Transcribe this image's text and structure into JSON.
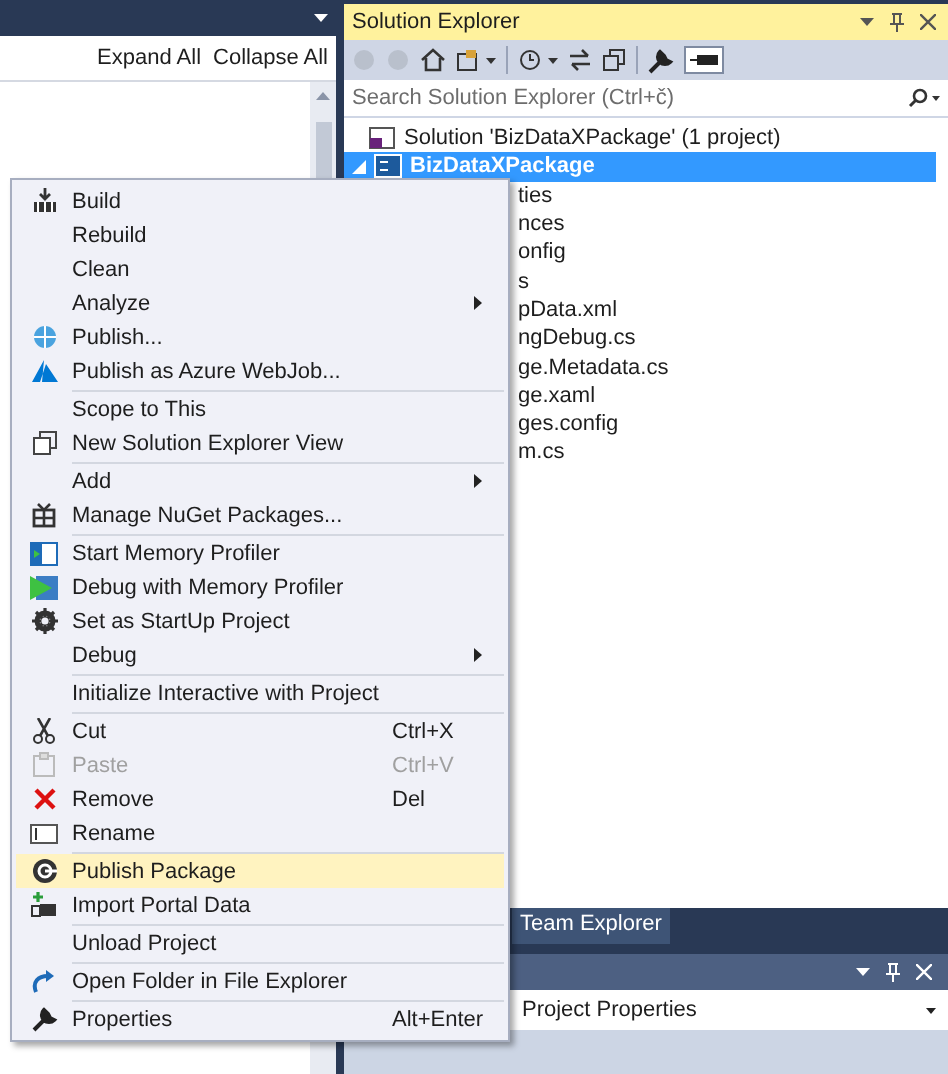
{
  "left_pane": {
    "toolbar": [
      "Expand All",
      "Collapse All"
    ]
  },
  "solution_explorer": {
    "title": "Solution Explorer",
    "search": {
      "placeholder": "Search Solution Explorer (Ctrl+č)"
    },
    "solution": {
      "label": "Solution 'BizDataXPackage' (1 project)"
    },
    "project": {
      "label": "BizDataXPackage",
      "selected": true,
      "expanded": true,
      "children": [
        {
          "label": "ties"
        },
        {
          "label": "nces"
        },
        {
          "label": "onfig"
        },
        {
          "label": "s"
        },
        {
          "label": "pData.xml"
        },
        {
          "label": "ngDebug.cs"
        },
        {
          "label": "ge.Metadata.cs"
        },
        {
          "label": "ge.xaml"
        },
        {
          "label": "ges.config"
        },
        {
          "label": "m.cs"
        }
      ]
    }
  },
  "bottom_tab": "Team Explorer",
  "properties_panel": {
    "dropdown": "Project Properties"
  },
  "context_menu": [
    {
      "kind": "item",
      "label": "Build",
      "selected": false,
      "disabled": false,
      "submenu": false
    },
    {
      "kind": "item",
      "label": "Rebuild",
      "selected": false,
      "disabled": false,
      "submenu": false
    },
    {
      "kind": "item",
      "label": "Clean",
      "selected": false,
      "disabled": false,
      "submenu": false
    },
    {
      "kind": "item",
      "label": "Analyze",
      "selected": false,
      "disabled": false,
      "submenu": true
    },
    {
      "kind": "item",
      "label": "Publish...",
      "selected": false,
      "disabled": false,
      "submenu": false
    },
    {
      "kind": "item",
      "label": "Publish as Azure WebJob...",
      "selected": false,
      "disabled": false,
      "submenu": false
    },
    {
      "kind": "separator"
    },
    {
      "kind": "item",
      "label": "Scope to This",
      "selected": false,
      "disabled": false,
      "submenu": false
    },
    {
      "kind": "item",
      "label": "New Solution Explorer View",
      "selected": false,
      "disabled": false,
      "submenu": false
    },
    {
      "kind": "separator"
    },
    {
      "kind": "item",
      "label": "Add",
      "selected": false,
      "disabled": false,
      "submenu": true
    },
    {
      "kind": "item",
      "label": "Manage NuGet Packages...",
      "selected": false,
      "disabled": false,
      "submenu": false
    },
    {
      "kind": "separator"
    },
    {
      "kind": "item",
      "label": "Start Memory Profiler",
      "selected": false,
      "disabled": false,
      "submenu": false
    },
    {
      "kind": "item",
      "label": "Debug with Memory Profiler",
      "selected": false,
      "disabled": false,
      "submenu": false
    },
    {
      "kind": "item",
      "label": "Set as StartUp Project",
      "selected": false,
      "disabled": false,
      "submenu": false
    },
    {
      "kind": "item",
      "label": "Debug",
      "selected": false,
      "disabled": false,
      "submenu": true
    },
    {
      "kind": "separator"
    },
    {
      "kind": "item",
      "label": "Initialize Interactive with Project",
      "selected": false,
      "disabled": false,
      "submenu": false
    },
    {
      "kind": "separator"
    },
    {
      "kind": "item",
      "label": "Cut",
      "shortcut": "Ctrl+X",
      "selected": false,
      "disabled": false,
      "submenu": false
    },
    {
      "kind": "item",
      "label": "Paste",
      "shortcut": "Ctrl+V",
      "selected": false,
      "disabled": true,
      "submenu": false
    },
    {
      "kind": "item",
      "label": "Remove",
      "shortcut": "Del",
      "selected": false,
      "disabled": false,
      "submenu": false
    },
    {
      "kind": "item",
      "label": "Rename",
      "selected": false,
      "disabled": false,
      "submenu": false
    },
    {
      "kind": "separator"
    },
    {
      "kind": "item",
      "label": "Publish Package",
      "selected": true,
      "disabled": false,
      "submenu": false
    },
    {
      "kind": "item",
      "label": "Import Portal Data",
      "selected": false,
      "disabled": false,
      "submenu": false
    },
    {
      "kind": "separator"
    },
    {
      "kind": "item",
      "label": "Unload Project",
      "selected": false,
      "disabled": false,
      "submenu": false
    },
    {
      "kind": "separator"
    },
    {
      "kind": "item",
      "label": "Open Folder in File Explorer",
      "selected": false,
      "disabled": false,
      "submenu": false
    },
    {
      "kind": "separator"
    },
    {
      "kind": "item",
      "label": "Properties",
      "shortcut": "Alt+Enter",
      "selected": false,
      "disabled": false,
      "submenu": false
    }
  ]
}
